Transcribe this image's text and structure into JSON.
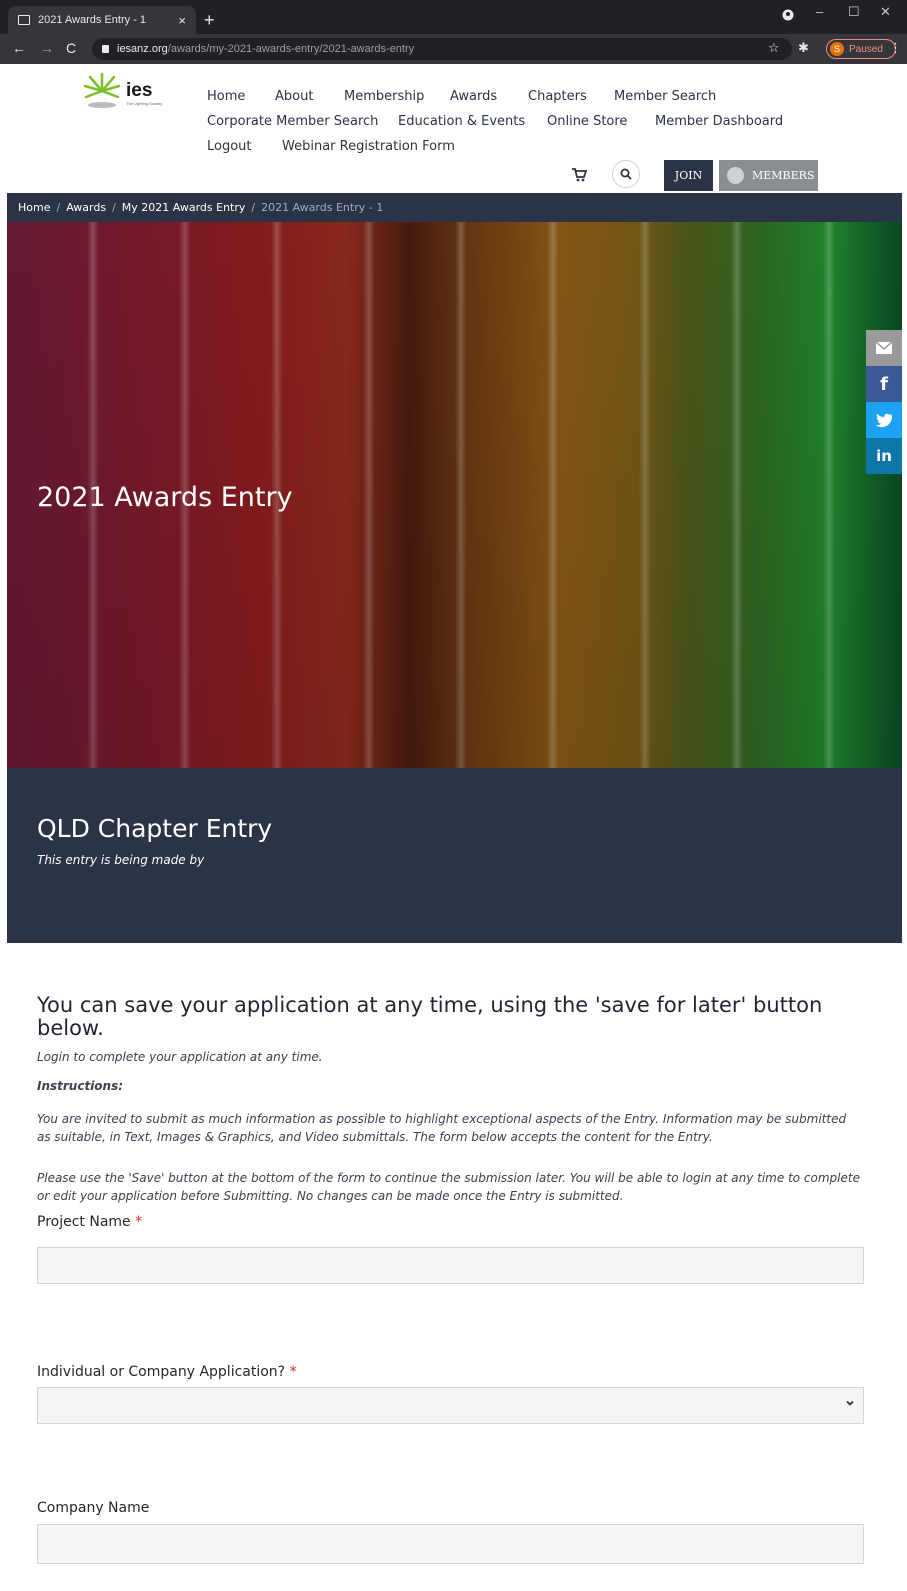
{
  "browser": {
    "tab_title": "2021 Awards Entry - 1",
    "url_domain": "iesanz.org",
    "url_path": "/awards/my-2021-awards-entry/2021-awards-entry",
    "profile_initial": "S",
    "profile_status": "Paused"
  },
  "site": {
    "logo_text": "ies",
    "logo_sub": "The Lighting Society",
    "nav": [
      "Home",
      "About",
      "Membership",
      "Awards",
      "Chapters",
      "Member Search",
      "Corporate Member Search",
      "Education & Events",
      "Online Store",
      "Member Dashboard",
      "Logout",
      "Webinar Registration Form"
    ],
    "join_label": "JOIN",
    "members_label": "MEMBERS"
  },
  "breadcrumb": {
    "items": [
      "Home",
      "Awards",
      "My 2021 Awards Entry"
    ],
    "current": "2021 Awards Entry - 1",
    "separator": "/"
  },
  "hero": {
    "title": "2021 Awards Entry"
  },
  "share": {
    "email_icon": "envelope-icon",
    "facebook": "f",
    "twitter_icon": "twitter-bird-icon",
    "linkedin": "in",
    "colors": {
      "email": "#9a9a9a",
      "facebook": "#3b5998",
      "twitter": "#1da1f2",
      "linkedin": "#0e76a8"
    }
  },
  "chapter": {
    "title": "QLD Chapter Entry",
    "subtitle": "This entry is being made by"
  },
  "form": {
    "heading": "You can save your application at any time, using the 'save for later' button below.",
    "login_note": "Login to complete your application at any time.",
    "instructions_title": "Instructions:",
    "instructions_p1": "You are invited to submit as much information as possible to highlight exceptional aspects of the Entry. Information may be submitted as suitable, in Text, Images & Graphics, and Video submittals. The form below accepts the content for the Entry.",
    "instructions_p2": "Please use the 'Save' button at the bottom of the form to continue the submission later. You will be able to login at any time to complete or edit your application before Submitting. No changes can be made once the Entry is submitted.",
    "project_name_label": "Project Name",
    "application_type_label": "Individual or Company Application?",
    "company_name_label": "Company Name",
    "required_mark": "*",
    "project_name_value": "",
    "application_type_value": "",
    "company_name_value": ""
  },
  "colors": {
    "navy": "#2b3446",
    "required": "#e0201e",
    "members_btn": "#8a8d91"
  }
}
